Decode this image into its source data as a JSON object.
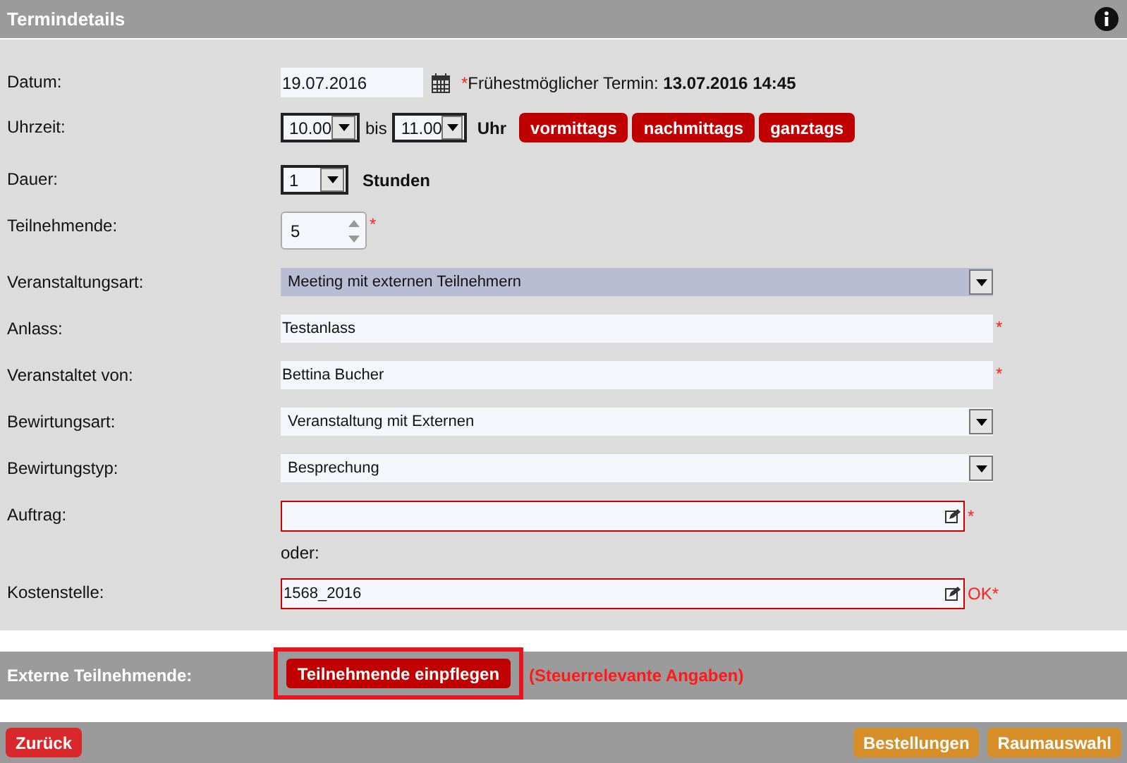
{
  "header": {
    "title": "Termindetails"
  },
  "rows": [
    {
      "kind": "date",
      "label": "Datum:",
      "value": "19.07.2016",
      "marker": "*",
      "note": "Frühestmöglicher Termin: **13.07.2016 14:45**"
    },
    {
      "kind": "time",
      "label": "Uhrzeit:",
      "from": "10.00",
      "between": "bis",
      "to": "11.00",
      "unit": "Uhr",
      "buttons": [
        "vormittags",
        "nachmittags",
        "ganztags"
      ]
    },
    {
      "kind": "duration",
      "label": "Dauer:",
      "value": "1",
      "unit": "Stunden"
    },
    {
      "kind": "number",
      "label": "Teilnehmende:",
      "value": "5",
      "marker": "*"
    },
    {
      "kind": "select",
      "label": "Veranstaltungsart:",
      "value": "Meeting mit externen Teilnehmern",
      "highlighted": true
    },
    {
      "kind": "text",
      "label": "Anlass:",
      "value": "Testanlass",
      "marker": "*"
    },
    {
      "kind": "text",
      "label": "Veranstaltet von:",
      "value": "Bettina Bucher",
      "marker": "*"
    },
    {
      "kind": "select",
      "label": "Bewirtungsart:",
      "value": "Veranstaltung mit Externen",
      "highlighted": false
    },
    {
      "kind": "select",
      "label": "Bewirtungstyp:",
      "value": "Besprechung",
      "highlighted": false
    },
    {
      "kind": "lookup",
      "label": "Auftrag:",
      "marker": "*",
      "error": true
    },
    {
      "kind": "note",
      "text": "oder:"
    },
    {
      "kind": "lookup",
      "label": "Kostenstelle:",
      "value": "1568_2016",
      "marker": "OK*",
      "error": true
    }
  ],
  "external": {
    "label": "Externe Teilnehmende:",
    "button": "Teilnehmende einpflegen",
    "note": "(Steuerrelevante Angaben)"
  },
  "footer": {
    "back": "Zurück",
    "buttons": [
      "Bestellungen",
      "Raumauswahl"
    ]
  }
}
